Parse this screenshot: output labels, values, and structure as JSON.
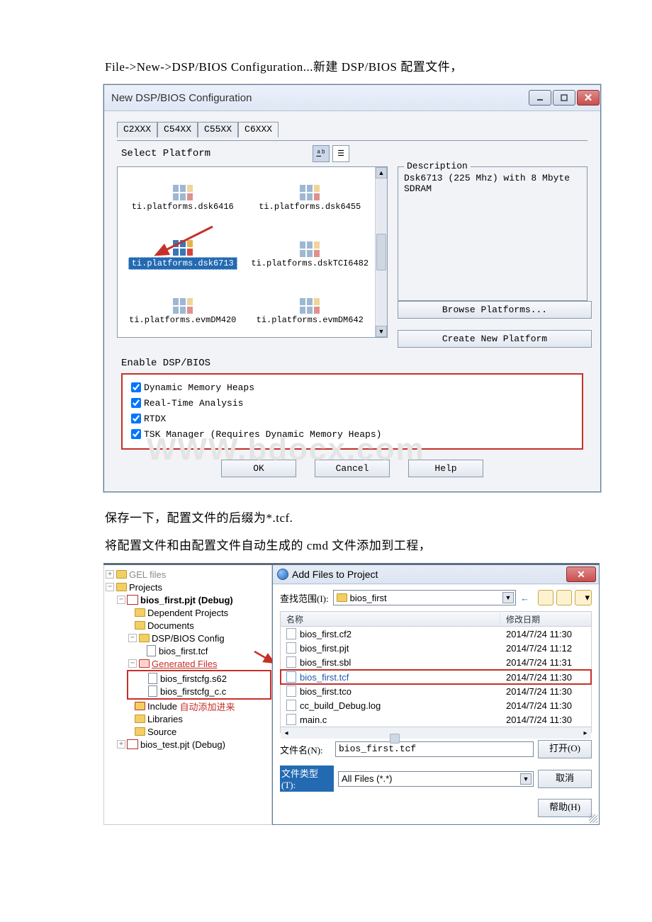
{
  "intro_line": "File->New->DSP/BIOS Configuration...新建 DSP/BIOS 配置文件，",
  "mid_line1": "保存一下，配置文件的后缀为*.tcf.",
  "mid_line2": "将配置文件和由配置文件自动生成的 cmd 文件添加到工程，",
  "dialog1": {
    "title": "New DSP/BIOS Configuration",
    "tabs": [
      "C2XXX",
      "C54XX",
      "C55XX",
      "C6XXX"
    ],
    "active_tab_index": 3,
    "select_label": "Select Platform",
    "platforms": [
      "ti.platforms.dsk6416",
      "ti.platforms.dsk6455",
      "ti.platforms.dsk6713",
      "ti.platforms.dskTCI6482",
      "ti.platforms.evmDM420",
      "ti.platforms.evmDM642"
    ],
    "selected_platform_index": 2,
    "description_title": "Description",
    "description_text": "Dsk6713 (225 Mhz) with 8 Mbyte SDRAM",
    "browse_btn": "Browse Platforms...",
    "create_btn": "Create New Platform",
    "enable_label": "Enable DSP/BIOS",
    "checks": [
      {
        "label": "Dynamic Memory Heaps",
        "checked": true
      },
      {
        "label": "Real-Time Analysis",
        "checked": true
      },
      {
        "label": "RTDX",
        "checked": true
      },
      {
        "label": "TSK Manager (Requires Dynamic Memory Heaps)",
        "checked": true
      }
    ],
    "ok": "OK",
    "cancel": "Cancel",
    "help": "Help",
    "watermark": "WWW.bdocx.com"
  },
  "tree": {
    "gel": "GEL files",
    "projects": "Projects",
    "proj1": "bios_first.pjt (Debug)",
    "dep": "Dependent Projects",
    "docs": "Documents",
    "dspcfg": "DSP/BIOS Config",
    "tcf": "bios_first.tcf",
    "gen": "Generated Files",
    "g1": "bios_firstcfg.s62",
    "g2": "bios_firstcfg_c.c",
    "inc": "Include",
    "inc_note": "自动添加进来",
    "lib": "Libraries",
    "src": "Source",
    "proj2": "bios_test.pjt (Debug)"
  },
  "addfiles": {
    "title": "Add Files to Project",
    "look_in_label": "查找范围(I):",
    "folder": "bios_first",
    "col_name": "名称",
    "col_date": "修改日期",
    "rows": [
      {
        "name": "bios_first.cf2",
        "date": "2014/7/24 11:30"
      },
      {
        "name": "bios_first.pjt",
        "date": "2014/7/24 11:12"
      },
      {
        "name": "bios_first.sbl",
        "date": "2014/7/24 11:31"
      },
      {
        "name": "bios_first.tcf",
        "date": "2014/7/24 11:30"
      },
      {
        "name": "bios_first.tco",
        "date": "2014/7/24 11:30"
      },
      {
        "name": "cc_build_Debug.log",
        "date": "2014/7/24 11:30"
      },
      {
        "name": "main.c",
        "date": "2014/7/24 11:30"
      }
    ],
    "highlight_row_index": 3,
    "filename_label": "文件名(N):",
    "filename_value": "bios_first.tcf",
    "filetype_label": "文件类型(T):",
    "filetype_value": "All Files (*.*)",
    "open_btn": "打开(O)",
    "cancel_btn": "取消",
    "help_btn": "帮助(H)"
  }
}
